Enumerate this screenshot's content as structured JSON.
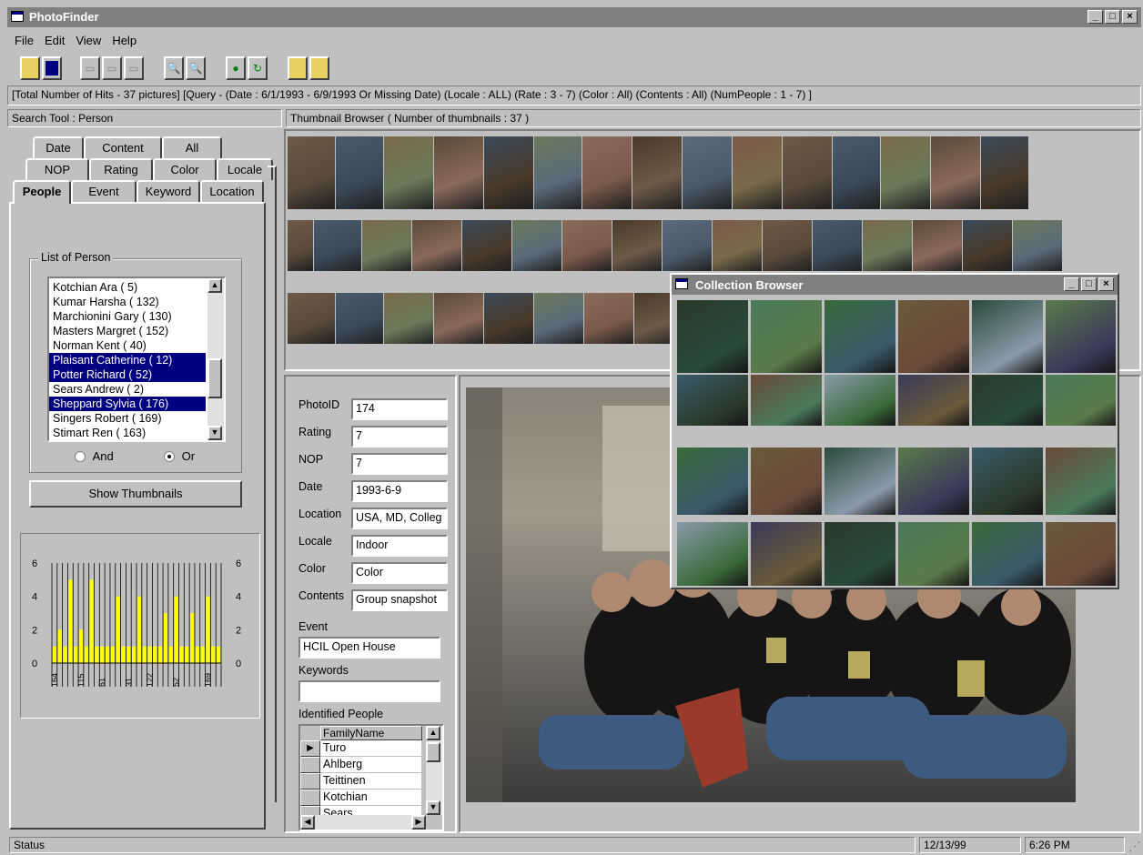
{
  "window": {
    "title": "PhotoFinder",
    "controls": [
      "_",
      "□",
      "×"
    ]
  },
  "menu": [
    "File",
    "Edit",
    "View",
    "Help"
  ],
  "hits_bar": "[Total Number of Hits -  37 pictures]   [Query - (Date : 6/1/1993 - 6/9/1993 Or Missing Date) (Locale : ALL) (Rate : 3 - 7) (Color : All) (Contents : All) (NumPeople : 1 - 7) ]",
  "search_tool": {
    "header": "Search Tool : Person",
    "tabs_row1": [
      "Date",
      "Content",
      "All"
    ],
    "tabs_row2": [
      "NOP",
      "Rating",
      "Color",
      "Locale"
    ],
    "tabs_row3": [
      "People",
      "Event",
      "Keyword",
      "Location"
    ],
    "group_label": "List of Person",
    "persons": [
      {
        "name": "Kotchian Ara ( 5)",
        "selected": false
      },
      {
        "name": "Kumar Harsha ( 132)",
        "selected": false
      },
      {
        "name": "Marchionini Gary ( 130)",
        "selected": false
      },
      {
        "name": "Masters Margret ( 152)",
        "selected": false
      },
      {
        "name": "Norman Kent ( 40)",
        "selected": false
      },
      {
        "name": "Plaisant Catherine ( 12)",
        "selected": true
      },
      {
        "name": "Potter Richard ( 52)",
        "selected": true
      },
      {
        "name": "Sears Andrew ( 2)",
        "selected": false
      },
      {
        "name": "Sheppard Sylvia ( 176)",
        "selected": true
      },
      {
        "name": "Singers Robert ( 169)",
        "selected": false
      },
      {
        "name": "Stimart Ren ( 163)",
        "selected": false
      }
    ],
    "radio_and": "And",
    "radio_or": "Or",
    "selected_radio": "Or",
    "show_button": "Show Thumbnails"
  },
  "chart_data": {
    "type": "bar",
    "ylim": [
      0,
      6
    ],
    "yticks": [
      "6",
      "4",
      "2",
      "0"
    ],
    "categories": [
      "164",
      "",
      "",
      "",
      "",
      "115",
      "",
      "",
      "",
      "61",
      "",
      "",
      "",
      "",
      "31",
      "",
      "",
      "",
      "122",
      "",
      "",
      "",
      "",
      "52",
      "",
      "",
      "",
      "",
      "",
      "169",
      "",
      ""
    ],
    "values": [
      1,
      2,
      1,
      5,
      1,
      2,
      1,
      5,
      1,
      1,
      1,
      1,
      4,
      1,
      1,
      1,
      4,
      1,
      1,
      1,
      1,
      3,
      1,
      4,
      1,
      1,
      3,
      1,
      1,
      4,
      1,
      1
    ],
    "bar_color": "#ffff00",
    "grid": true
  },
  "thumbnail_browser": {
    "header": "Thumbnail Browser ( Number of thumbnails :  37 )"
  },
  "details": {
    "photoid_label": "PhotoID",
    "photoid": "174",
    "rating_label": "Rating",
    "rating": "7",
    "nop_label": "NOP",
    "nop": "7",
    "date_label": "Date",
    "date": "1993-6-9",
    "location_label": "Location",
    "location": "USA, MD, Colleg",
    "locale_label": "Locale",
    "locale": "Indoor",
    "color_label": "Color",
    "color": "Color",
    "contents_label": "Contents",
    "contents": "Group snapshot",
    "event_label": "Event",
    "event": "HCIL Open House",
    "keywords_label": "Keywords",
    "keywords": "",
    "identified_label": "Identified People",
    "grid_header": "FamilyName",
    "people": [
      "Turo",
      "Ahlberg",
      "Teittinen",
      "Kotchian",
      "Sears"
    ]
  },
  "collection_browser": {
    "title": "Collection Browser"
  },
  "status": {
    "text": "Status",
    "date": "12/13/99",
    "time": "6:26 PM"
  },
  "colors": {
    "titlebar_inactive": "#808080",
    "selection": "#000080",
    "face": "#c0c0c0"
  }
}
